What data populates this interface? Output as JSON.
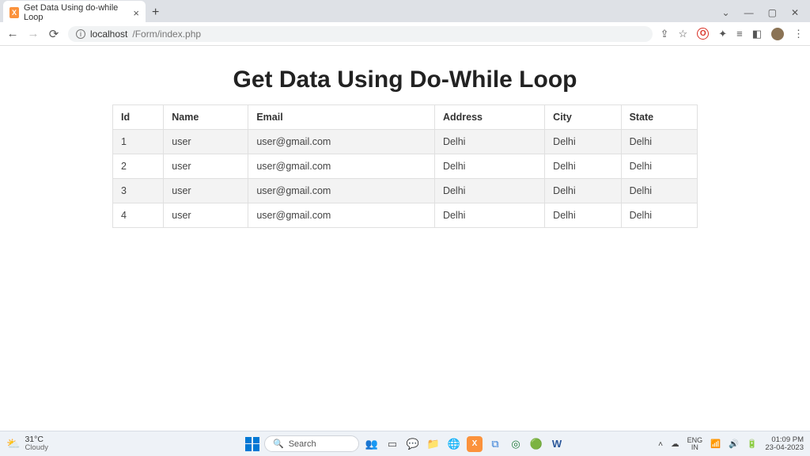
{
  "browser": {
    "tab_title": "Get Data Using do-while Loop",
    "url_host": "localhost",
    "url_path": "/Form/index.php"
  },
  "page": {
    "heading": "Get Data Using Do-While Loop",
    "columns": [
      "Id",
      "Name",
      "Email",
      "Address",
      "City",
      "State"
    ],
    "rows": [
      {
        "id": "1",
        "name": "user",
        "email": "user@gmail.com",
        "address": "Delhi",
        "city": "Delhi",
        "state": "Delhi"
      },
      {
        "id": "2",
        "name": "user",
        "email": "user@gmail.com",
        "address": "Delhi",
        "city": "Delhi",
        "state": "Delhi"
      },
      {
        "id": "3",
        "name": "user",
        "email": "user@gmail.com",
        "address": "Delhi",
        "city": "Delhi",
        "state": "Delhi"
      },
      {
        "id": "4",
        "name": "user",
        "email": "user@gmail.com",
        "address": "Delhi",
        "city": "Delhi",
        "state": "Delhi"
      }
    ]
  },
  "taskbar": {
    "temp": "31°C",
    "weather": "Cloudy",
    "search_placeholder": "Search",
    "lang_top": "ENG",
    "lang_bot": "IN",
    "time": "01:09 PM",
    "date": "23-04-2023"
  }
}
